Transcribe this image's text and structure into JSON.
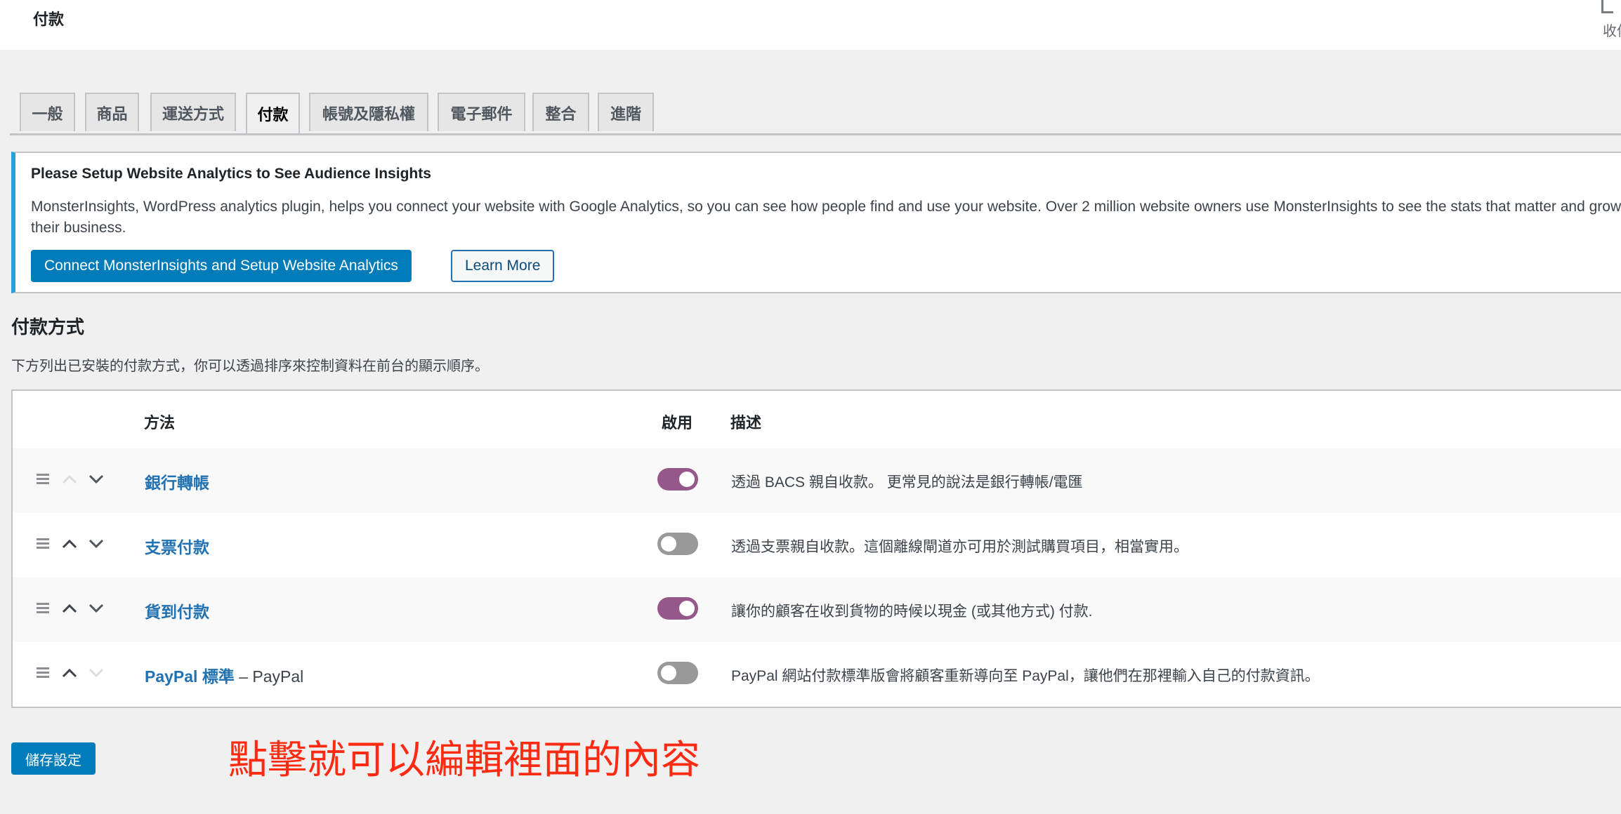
{
  "header": {
    "title": "付款",
    "inbox_label": "收件匣"
  },
  "tabs": [
    {
      "label": "一般",
      "active": false
    },
    {
      "label": "商品",
      "active": false
    },
    {
      "label": "運送方式",
      "active": false
    },
    {
      "label": "付款",
      "active": true
    },
    {
      "label": "帳號及隱私權",
      "active": false
    },
    {
      "label": "電子郵件",
      "active": false
    },
    {
      "label": "整合",
      "active": false
    },
    {
      "label": "進階",
      "active": false
    }
  ],
  "notice": {
    "title": "Please Setup Website Analytics to See Audience Insights",
    "text": "MonsterInsights, WordPress analytics plugin, helps you connect your website with Google Analytics, so you can see how people find and use your website. Over 2 million website owners use MonsterInsights to see the stats that matter and grow their business.",
    "primary_button": "Connect MonsterInsights and Setup Website Analytics",
    "secondary_button": "Learn More",
    "accent_color": "#2e9fd6"
  },
  "section": {
    "title": "付款方式",
    "description": "下方列出已安裝的付款方式，你可以透過排序來控制資料在前台的顯示順序。"
  },
  "table": {
    "columns": {
      "method": "方法",
      "enabled": "啟用",
      "description": "描述"
    },
    "rows": [
      {
        "name": "銀行轉帳",
        "suffix": "",
        "enabled": true,
        "can_move_up": false,
        "can_move_down": true,
        "description": "透過 BACS 親自收款。 更常見的說法是銀行轉帳/電匯"
      },
      {
        "name": "支票付款",
        "suffix": "",
        "enabled": false,
        "can_move_up": true,
        "can_move_down": true,
        "description": "透過支票親自收款。這個離線閘道亦可用於測試購買項目，相當實用。"
      },
      {
        "name": "貨到付款",
        "suffix": "",
        "enabled": true,
        "can_move_up": true,
        "can_move_down": true,
        "description": "讓你的顧客在收到貨物的時候以現金 (或其他方式) 付款."
      },
      {
        "name": "PayPal 標準",
        "suffix": " – PayPal",
        "enabled": false,
        "can_move_up": true,
        "can_move_down": false,
        "description": "PayPal 網站付款標準版會將顧客重新導向至 PayPal，讓他們在那裡輸入自己的付款資訊。"
      }
    ],
    "toggle_on_color": "#96588a",
    "toggle_off_color": "#999999"
  },
  "save_button": "儲存設定",
  "annotation": "點擊就可以編輯裡面的內容"
}
